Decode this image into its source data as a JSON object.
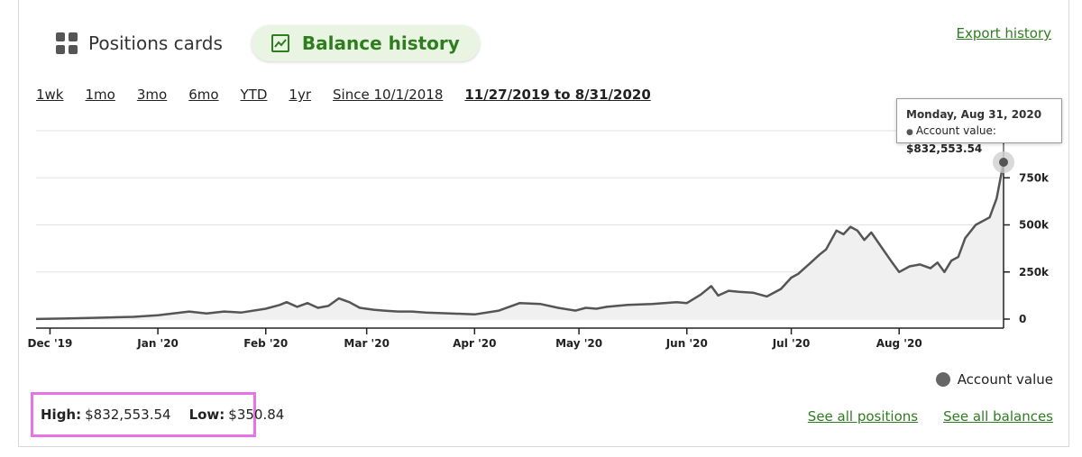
{
  "tabs": {
    "positions_label": "Positions cards",
    "balance_label": "Balance history"
  },
  "export_label": "Export history",
  "ranges": [
    "1wk",
    "1mo",
    "3mo",
    "6mo",
    "YTD",
    "1yr",
    "Since 10/1/2018",
    "11/27/2019 to 8/31/2020"
  ],
  "active_range": "11/27/2019 to 8/31/2020",
  "tooltip": {
    "date": "Monday, Aug 31, 2020",
    "series": "Account value",
    "value": "$832,553.54"
  },
  "legend_label": "Account value",
  "highlow": {
    "high_label": "High:",
    "high_value": "$832,553.54",
    "low_label": "Low:",
    "low_value": "$350.84"
  },
  "footer": {
    "positions_link": "See all positions",
    "balances_link": "See all balances"
  },
  "colors": {
    "accent_green": "#2e7d1f",
    "tab_bg": "#e9f5e2",
    "line": "#555555",
    "area": "#f0f0f0",
    "highlight_border": "#e873e8"
  },
  "chart_data": {
    "type": "area",
    "x_ticks": [
      "Dec '19",
      "Jan '20",
      "Feb '20",
      "Mar '20",
      "Apr '20",
      "May '20",
      "Jun '20",
      "Jul '20",
      "Aug '20"
    ],
    "x_tick_dates": [
      "2019-12-01",
      "2020-01-01",
      "2020-02-01",
      "2020-03-01",
      "2020-04-01",
      "2020-05-01",
      "2020-06-01",
      "2020-07-01",
      "2020-08-01"
    ],
    "y_ticks": [
      0,
      250000,
      500000,
      750000
    ],
    "y_tick_labels": [
      "0",
      "250k",
      "500k",
      "750k"
    ],
    "ylim": [
      0,
      1000000
    ],
    "xlim": [
      "2019-11-27",
      "2020-08-31"
    ],
    "grid": true,
    "series": [
      {
        "name": "Account value",
        "x": [
          "2019-11-27",
          "2019-12-05",
          "2019-12-15",
          "2019-12-25",
          "2020-01-01",
          "2020-01-10",
          "2020-01-15",
          "2020-01-20",
          "2020-01-25",
          "2020-02-01",
          "2020-02-05",
          "2020-02-07",
          "2020-02-10",
          "2020-02-13",
          "2020-02-16",
          "2020-02-19",
          "2020-02-22",
          "2020-02-25",
          "2020-02-28",
          "2020-03-03",
          "2020-03-06",
          "2020-03-10",
          "2020-03-14",
          "2020-03-18",
          "2020-03-25",
          "2020-04-01",
          "2020-04-08",
          "2020-04-14",
          "2020-04-20",
          "2020-04-25",
          "2020-04-30",
          "2020-05-03",
          "2020-05-06",
          "2020-05-09",
          "2020-05-15",
          "2020-05-22",
          "2020-05-29",
          "2020-06-01",
          "2020-06-05",
          "2020-06-08",
          "2020-06-10",
          "2020-06-13",
          "2020-06-16",
          "2020-06-20",
          "2020-06-24",
          "2020-06-28",
          "2020-07-01",
          "2020-07-03",
          "2020-07-06",
          "2020-07-09",
          "2020-07-11",
          "2020-07-14",
          "2020-07-16",
          "2020-07-18",
          "2020-07-20",
          "2020-07-22",
          "2020-07-24",
          "2020-07-27",
          "2020-07-30",
          "2020-08-01",
          "2020-08-04",
          "2020-08-07",
          "2020-08-10",
          "2020-08-12",
          "2020-08-14",
          "2020-08-16",
          "2020-08-18",
          "2020-08-20",
          "2020-08-23",
          "2020-08-25",
          "2020-08-27",
          "2020-08-29",
          "2020-08-31"
        ],
        "values": [
          350.84,
          3000,
          7000,
          12000,
          20000,
          40000,
          30000,
          40000,
          35000,
          55000,
          75000,
          90000,
          65000,
          85000,
          60000,
          70000,
          110000,
          90000,
          60000,
          50000,
          45000,
          40000,
          40000,
          35000,
          30000,
          25000,
          45000,
          85000,
          80000,
          60000,
          45000,
          60000,
          55000,
          65000,
          75000,
          80000,
          90000,
          85000,
          130000,
          175000,
          125000,
          150000,
          145000,
          140000,
          120000,
          160000,
          220000,
          240000,
          290000,
          340000,
          370000,
          470000,
          450000,
          490000,
          470000,
          420000,
          460000,
          380000,
          300000,
          250000,
          280000,
          290000,
          270000,
          300000,
          250000,
          310000,
          330000,
          430000,
          500000,
          520000,
          540000,
          640000,
          832553.54
        ]
      }
    ]
  }
}
